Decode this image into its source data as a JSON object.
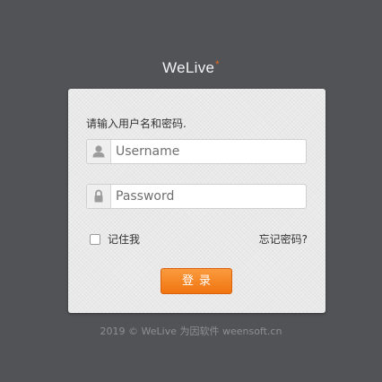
{
  "brand": {
    "name": "WeLive",
    "mark": "*"
  },
  "login": {
    "prompt": "请输入用户名和密码.",
    "username_placeholder": "Username",
    "password_placeholder": "Password",
    "remember_label": "记住我",
    "remember_checked": false,
    "forgot_label": "忘记密码?",
    "submit_label": "登录"
  },
  "icons": {
    "username": "user-icon",
    "password": "lock-icon"
  },
  "colors": {
    "background": "#525357",
    "panel": "#eeeeee",
    "accent": "#f0740f",
    "brand_mark": "#f06a16"
  },
  "footer": {
    "text": "2019 © WeLive 为因软件 weensoft.cn"
  }
}
